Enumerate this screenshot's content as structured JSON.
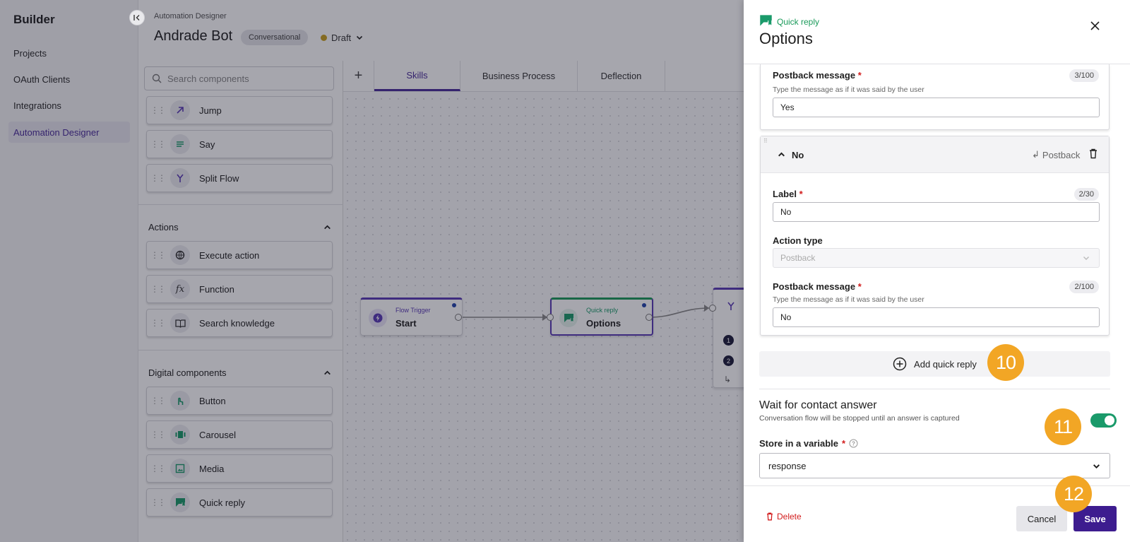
{
  "nav": {
    "title": "Builder",
    "items": [
      {
        "label": "Projects"
      },
      {
        "label": "OAuth Clients"
      },
      {
        "label": "Integrations"
      },
      {
        "label": "Automation Designer"
      }
    ]
  },
  "header": {
    "breadcrumb": "Automation Designer",
    "title": "Andrade Bot",
    "type_chip": "Conversational",
    "status": "Draft"
  },
  "search": {
    "placeholder": "Search components"
  },
  "components": {
    "flow": [
      {
        "label": "Jump",
        "icon": "arrow-up-right-icon"
      },
      {
        "label": "Say",
        "icon": "lines-icon"
      },
      {
        "label": "Split Flow",
        "icon": "split-icon"
      }
    ],
    "actions_title": "Actions",
    "actions": [
      {
        "label": "Execute action",
        "icon": "globe-icon"
      },
      {
        "label": "Function",
        "icon": "fx-icon"
      },
      {
        "label": "Search knowledge",
        "icon": "book-icon"
      }
    ],
    "digital_title": "Digital components",
    "digital": [
      {
        "label": "Button",
        "icon": "tap-icon"
      },
      {
        "label": "Carousel",
        "icon": "carousel-icon"
      },
      {
        "label": "Media",
        "icon": "image-icon"
      },
      {
        "label": "Quick reply",
        "icon": "quick-reply-icon"
      }
    ]
  },
  "tabs": [
    {
      "label": "Skills"
    },
    {
      "label": "Business Process"
    },
    {
      "label": "Deflection"
    }
  ],
  "canvas": {
    "nodes": [
      {
        "subtitle": "Flow Trigger",
        "title": "Start"
      },
      {
        "subtitle": "Quick reply",
        "title": "Options"
      }
    ],
    "partial_node_rows": [
      "1",
      "2"
    ]
  },
  "drawer": {
    "subtitle": "Quick reply",
    "title": "Options",
    "first_reply": {
      "postback_label": "Postback message",
      "postback_help": "Type the message as if it was said by the user",
      "postback_counter": "3/100",
      "postback_value": "Yes"
    },
    "second_reply": {
      "name": "No",
      "action_label": "Postback",
      "label_label": "Label",
      "label_counter": "2/30",
      "label_value": "No",
      "action_type_label": "Action type",
      "action_type_value": "Postback",
      "postback_label": "Postback message",
      "postback_help": "Type the message as if it was said by the user",
      "postback_counter": "2/100",
      "postback_value": "No"
    },
    "add_quick_reply": "Add quick reply",
    "wait": {
      "title": "Wait for contact answer",
      "help": "Conversation flow will be stopped until an answer is captured",
      "enabled": true
    },
    "store": {
      "label": "Store in a variable",
      "value": "response"
    },
    "delete_label": "Delete",
    "cancel_label": "Cancel",
    "save_label": "Save"
  },
  "steps": [
    "10",
    "11",
    "12"
  ],
  "colors": {
    "accent": "#4a2d99",
    "success": "#1a9a6a",
    "danger": "#d21c1c",
    "step": "#f2a625"
  }
}
